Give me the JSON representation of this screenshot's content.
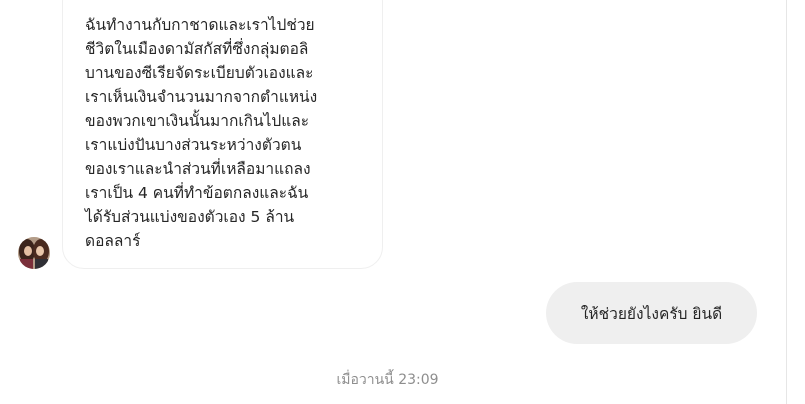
{
  "incoming_message": {
    "text": "ฉันทำงานกับกาชาดและเราไปช่วย\nชีวิตในเมืองดามัสกัสที่ซึ่งกลุ่มตอลิ\nบานของซีเรียจัดระเบียบตัวเองและ\nเราเห็นเงินจำนวนมากจากตำแหน่ง\nของพวกเขาเงินนั้นมากเกินไปและ\nเราแบ่งปันบางส่วนระหว่างตัวตน\nของเราและนำส่วนที่เหลือมาแถลง\nเราเป็น 4 คนที่ทำข้อตกลงและฉัน\nได้รับส่วนแบ่งของตัวเอง 5 ล้าน\nดอลลาร์"
  },
  "outgoing_message": {
    "text": "ให้ช่วยยังไงครับ ยินดี"
  },
  "timestamp": "เมื่อวานนี้ 23:09",
  "colors": {
    "bubble_outgoing": "#efefef",
    "bubble_border": "#efefef",
    "text": "#262626",
    "timestamp": "#8e8e8e"
  }
}
